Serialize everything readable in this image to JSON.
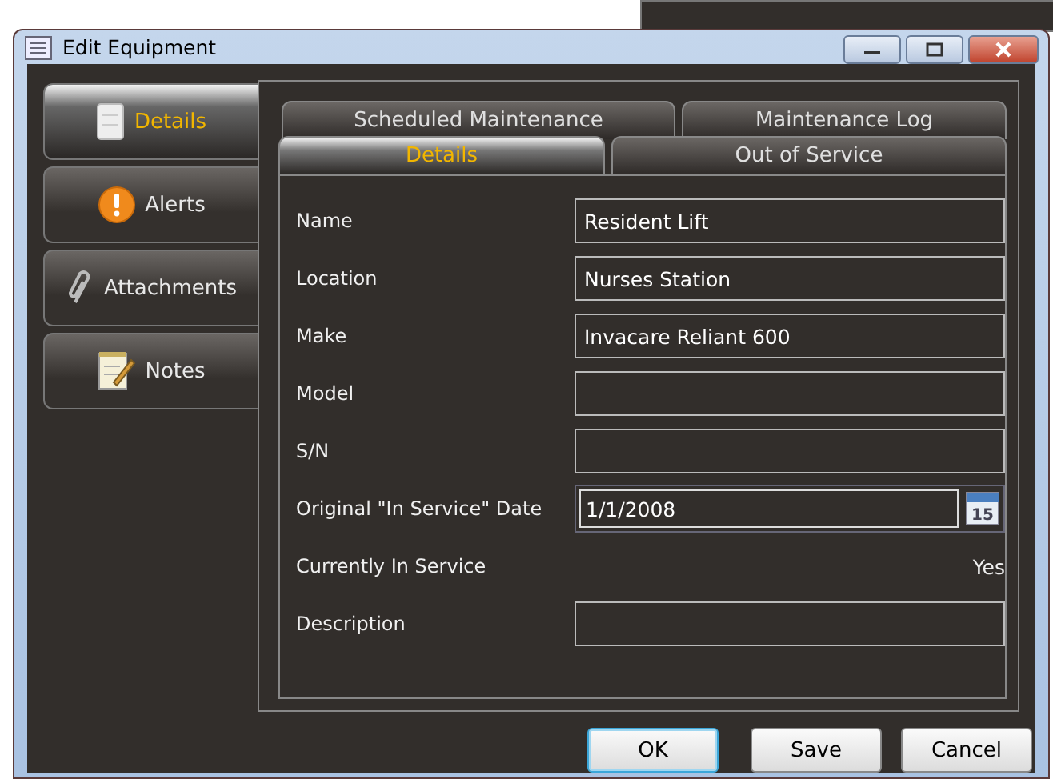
{
  "window": {
    "title": "Edit Equipment"
  },
  "side_tabs": [
    {
      "label": "Details",
      "selected": true
    },
    {
      "label": "Alerts",
      "selected": false
    },
    {
      "label": "Attachments",
      "selected": false
    },
    {
      "label": "Notes",
      "selected": false
    }
  ],
  "tab_rows": [
    [
      {
        "label": "Scheduled Maintenance",
        "selected": false
      },
      {
        "label": "Maintenance Log",
        "selected": false
      }
    ],
    [
      {
        "label": "Details",
        "selected": true
      },
      {
        "label": "Out of Service",
        "selected": false
      }
    ]
  ],
  "fields": [
    {
      "kind": "text",
      "label": "Name",
      "value": "Resident Lift"
    },
    {
      "kind": "text",
      "label": "Location",
      "value": "Nurses Station"
    },
    {
      "kind": "text",
      "label": "Make",
      "value": "Invacare Reliant 600"
    },
    {
      "kind": "text",
      "label": "Model"
    },
    {
      "kind": "text",
      "label": "S/N"
    },
    {
      "kind": "date",
      "label": "Original \"In Service\" Date",
      "value": "1/1/2008",
      "calendar_day": "15"
    },
    {
      "kind": "readonly",
      "label": "Currently In Service",
      "value": "Yes"
    },
    {
      "kind": "text",
      "label": "Description"
    }
  ],
  "buttons": [
    {
      "label": "OK",
      "default": true
    },
    {
      "label": "Save",
      "default": false
    },
    {
      "label": "Cancel",
      "default": false
    }
  ]
}
